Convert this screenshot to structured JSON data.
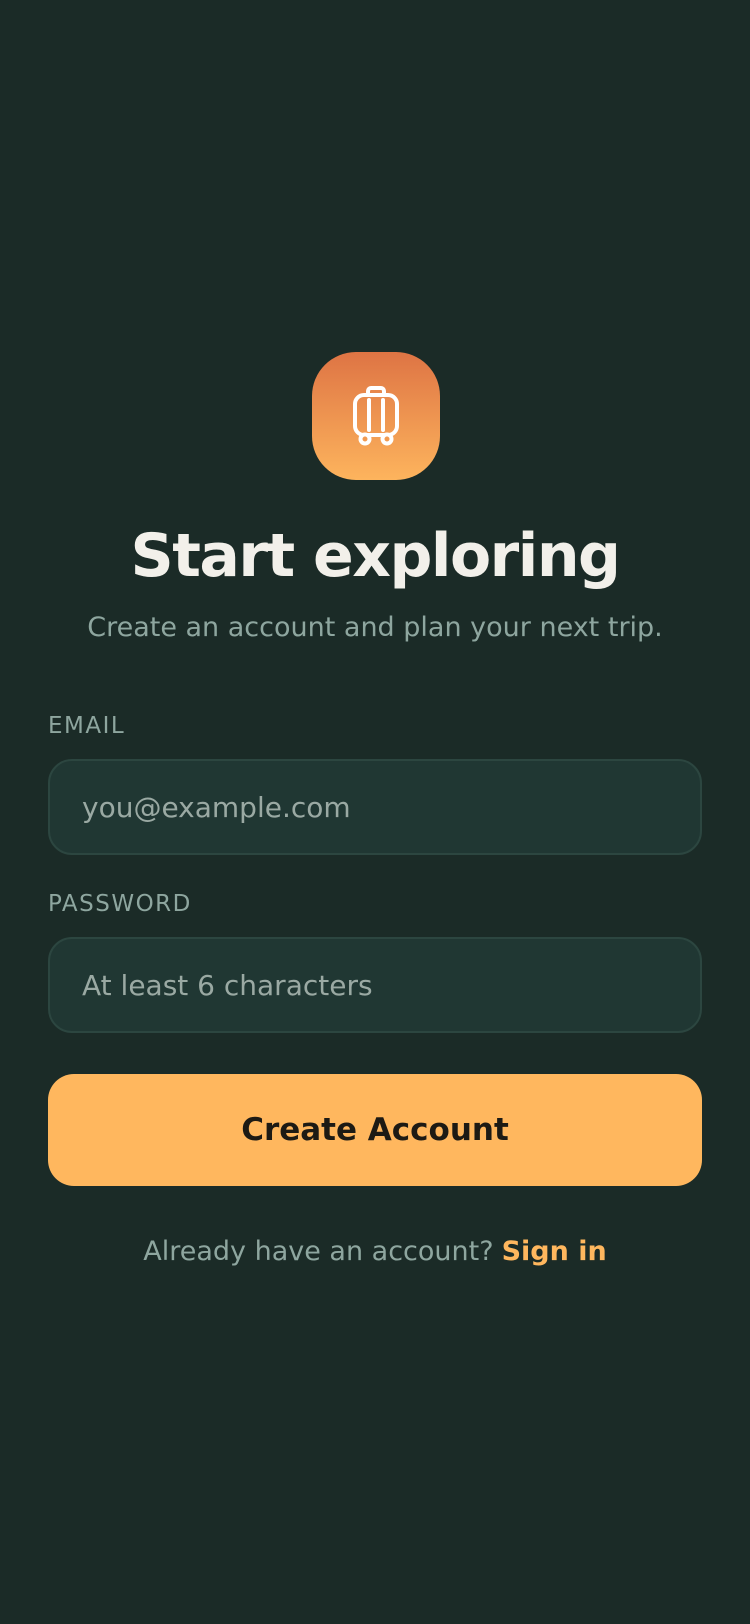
{
  "theme": {
    "background": "#1b2b27",
    "accent": "#ffb75e",
    "icon_gradient": [
      "#de7444",
      "#fdb45d"
    ]
  },
  "app_icon": {
    "icon": "luggage-icon"
  },
  "header": {
    "title": "Start exploring",
    "subtitle": "Create an account and plan your next trip."
  },
  "form": {
    "email": {
      "label": "EMAIL",
      "placeholder": "you@example.com",
      "value": ""
    },
    "password": {
      "label": "PASSWORD",
      "placeholder": "At least 6 characters",
      "value": ""
    },
    "submit_label": "Create Account"
  },
  "footer": {
    "prompt": "Already have an account?",
    "link_label": "Sign in"
  }
}
